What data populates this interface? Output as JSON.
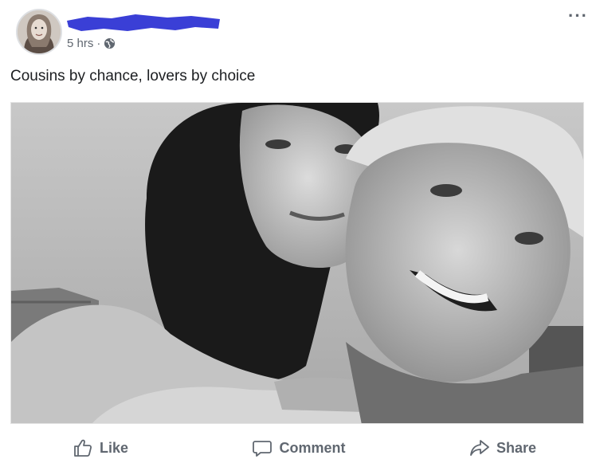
{
  "post": {
    "timestamp": "5 hrs",
    "separator": "·",
    "caption": "Cousins by chance, lovers by choice",
    "more_label": "···"
  },
  "actions": {
    "like": "Like",
    "comment": "Comment",
    "share": "Share"
  },
  "colors": {
    "redaction": "#3a3fd6",
    "action_text": "#606770"
  }
}
